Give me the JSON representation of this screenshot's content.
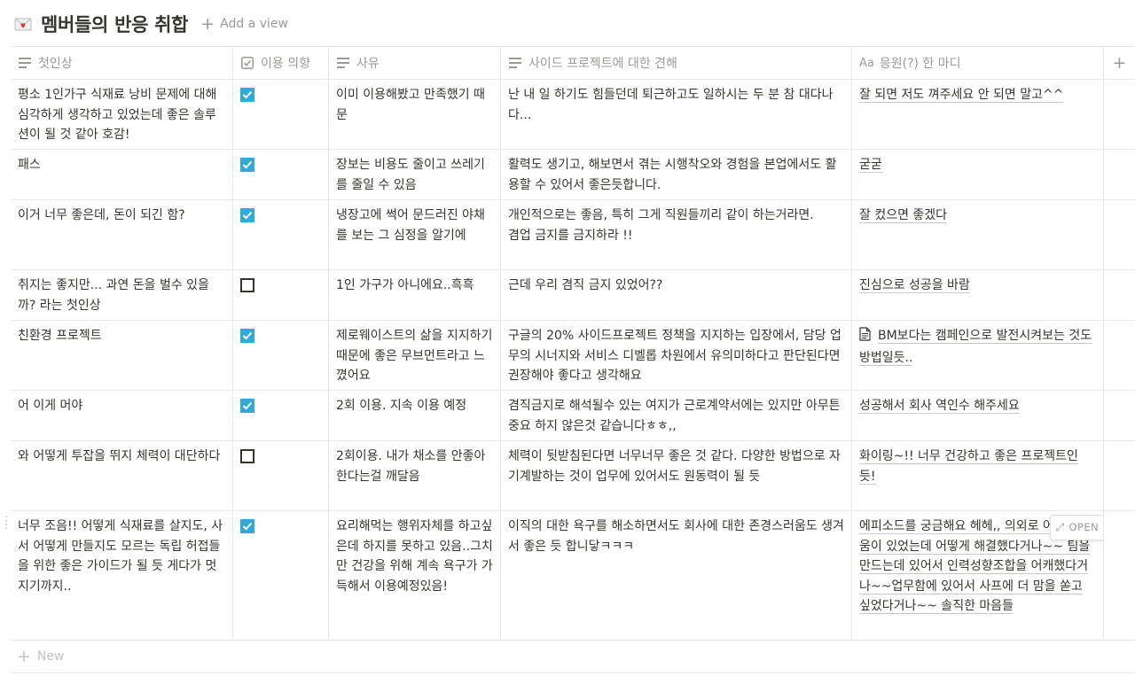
{
  "page": {
    "icon": "love-letter-icon",
    "title": "멤버들의 반응 취합",
    "add_view": "Add a view"
  },
  "columns": [
    {
      "label": "첫인상",
      "icon": "text-lines-icon"
    },
    {
      "label": "이용 의향",
      "icon": "checkbox-icon"
    },
    {
      "label": "사유",
      "icon": "text-lines-icon"
    },
    {
      "label": "사이드 프로젝트에 대한 견해",
      "icon": "text-lines-icon"
    },
    {
      "label": "응원(?) 한 마디",
      "icon": "title-aa-icon",
      "icon_text": "Aa"
    }
  ],
  "rows": [
    {
      "impression": "평소 1인가구 식재료 낭비 문제에 대해 심각하게 생각하고 있었는데 좋은 솔루션이 될 것 같아 호감!",
      "intent": true,
      "reason": "이미 이용해봤고 만족했기 때문",
      "opinion": "난 내 일 하기도 힘들던데 퇴근하고도 일하시는 두 분 참 대다나다...",
      "cheer": "잘 되면 저도 껴주세요 안 되면 말고^^"
    },
    {
      "impression": "패스",
      "intent": true,
      "reason": "장보는 비용도 줄이고 쓰레기를 줄일 수 있음",
      "opinion": "활력도 생기고, 해보면서 겪는 시행착오와 경험을 본업에서도 활용할 수 있어서 좋은듯합니다.",
      "cheer": "굳굳"
    },
    {
      "impression": "이거 너무 좋은데, 돈이 되긴 함?",
      "intent": true,
      "reason": "냉장고에 썩어 문드러진 야채를 보는 그 심정을 알기에",
      "opinion": "개인적으로는 좋음, 특히 그게 직원들끼리 같이 하는거라면.\n겸업 금지를 금지하라 !!",
      "cheer": "잘 컸으면 좋겠다"
    },
    {
      "impression": "취지는 좋지만... 과연 돈을 벌수 있을까? 라는 첫인상",
      "intent": false,
      "reason": "1인 가구가 아니에요..흑흑",
      "opinion": "근데 우리 겸직 금지 있었어??",
      "cheer": "진심으로 성공을 바람"
    },
    {
      "impression": "친환경 프로젝트",
      "intent": true,
      "reason": "제로웨이스트의 삶을 지지하기 때문에 좋은 무브먼트라고 느꼈어요",
      "opinion": "구글의 20% 사이드프로젝트 정책을 지지하는 입장에서, 담당 업무의 시너지와 서비스 디벨롭 차원에서 유의미하다고 판단된다면 권장해야 좋다고 생각해요",
      "cheer": "BM보다는 캠페인으로 발전시켜보는 것도 방법일듯..",
      "cheer_icon": "document-icon"
    },
    {
      "impression": "어 이게 머야",
      "intent": true,
      "reason": "2회 이용. 지속 이용 예정",
      "opinion": "겸직금지로 해석될수 있는 여지가 근로계약서에는 있지만 아무튼 중요 하지 않은것 같습니다ㅎㅎ,,",
      "cheer": "성공해서 회사 역인수 해주세요"
    },
    {
      "impression": "와 어떻게 투잡을 뛰지 체력이 대단하다",
      "intent": false,
      "reason": "2회이용. 내가 채소를 안좋아한다는걸 깨달음",
      "opinion": "체력이 뒷받침된다면 너무너무 좋은 것 같다. 다양한 방법으로 자기계발하는 것이 업무에 있어서도 원동력이 될 듯",
      "cheer": "화이링~!! 너무 건강하고 좋은 프로젝트인 듯!"
    },
    {
      "impression": "너무 조음!! 어떻게 식재료를 살지도, 사서 어떻게 만들지도 모르는 독립 허접들을 위한 좋은 가이드가 될 듯 게다가 멋지기까지..",
      "intent": true,
      "reason": "요리해먹는 행위자체를 하고싶은데 하지를 못하고 있음..그치만 건강을 위해 계속 욕구가 가득해서 이용예정있음!",
      "opinion": "이직의 대한 욕구를 해소하면서도 회사에 대한 존경스러움도 생겨서 좋은 듯 합니닿ㅋㅋㅋ",
      "cheer": "에피소드를 궁금해요 헤헤,, 의외로 어떤 어려움이 있었는데 어떻게 해결했다거나~~ 팀을 만드는데 있어서 인력성향조합을 어캐했다거나~~업무함에 있어서 사프에 더 맘을 쏟고 싶었다거나~~ 솔직한 마음들"
    }
  ],
  "hover": {
    "open_label": "OPEN"
  },
  "new_row": {
    "label": "New"
  },
  "colors": {
    "check_blue": "#2eaadc",
    "border": "#e9e9e7",
    "muted": "#9b9a97",
    "text": "#37352f"
  }
}
